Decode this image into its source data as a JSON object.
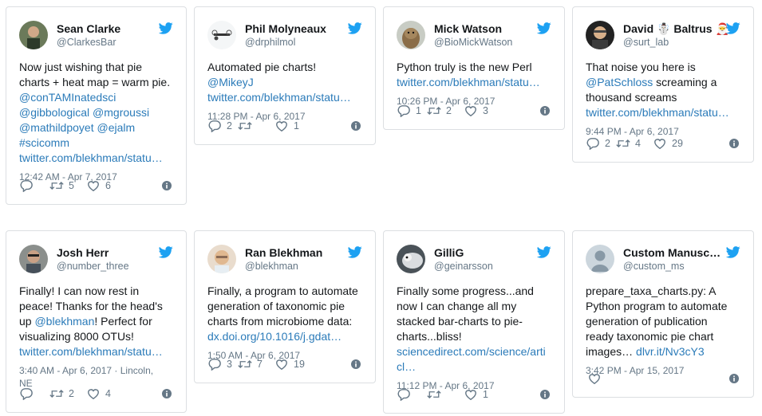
{
  "tweets": [
    {
      "name": "Sean Clarke",
      "handle": "@ClarkesBar",
      "avatar": "person-photo-avatar",
      "lines": [
        [
          {
            "t": "Now just wishing that pie",
            "link": false
          }
        ],
        [
          {
            "t": "charts + heat map = warm pie.",
            "link": false
          }
        ],
        [
          {
            "t": "@conTAMInatedsci",
            "link": true
          }
        ],
        [
          {
            "t": "@gibbological @mgroussi",
            "link": true
          }
        ],
        [
          {
            "t": "@mathildpoyet @ejalm",
            "link": true
          }
        ],
        [
          {
            "t": "#scicomm",
            "link": true
          }
        ],
        [
          {
            "t": "twitter.com/blekhman/statu…",
            "link": true
          }
        ]
      ],
      "time": "12:42 AM - Apr 7, 2017",
      "reply": "",
      "retweet": "5",
      "like": "6"
    },
    {
      "name": "Phil Molyneaux",
      "handle": "@drphilmol",
      "avatar": "drone-avatar",
      "lines": [
        [
          {
            "t": "Automated pie charts!",
            "link": false
          }
        ],
        [
          {
            "t": "@MikeyJ",
            "link": true
          }
        ],
        [
          {
            "t": "twitter.com/blekhman/statu…",
            "link": true
          }
        ]
      ],
      "time": "11:28 PM - Apr 6, 2017",
      "reply": "2",
      "retweet": "",
      "like": "1"
    },
    {
      "name": "Mick Watson",
      "handle": "@BioMickWatson",
      "avatar": "otter-avatar",
      "lines": [
        [
          {
            "t": "Python truly is the new Perl",
            "link": false
          }
        ],
        [
          {
            "t": "twitter.com/blekhman/statu…",
            "link": true
          }
        ]
      ],
      "time": "10:26 PM - Apr 6, 2017",
      "reply": "1",
      "retweet": "2",
      "like": "3"
    },
    {
      "name": "David ☃️ Baltrus 🎅",
      "handle": "@surt_lab",
      "avatar": "person-photo-avatar",
      "lines": [
        [
          {
            "t": "That noise you here is",
            "link": false
          }
        ],
        [
          {
            "t": "@PatSchloss",
            "link": true
          },
          {
            "t": " screaming a",
            "link": false
          }
        ],
        [
          {
            "t": "thousand screams",
            "link": false
          }
        ],
        [
          {
            "t": "twitter.com/blekhman/statu…",
            "link": true
          }
        ]
      ],
      "time": "9:44 PM - Apr 6, 2017",
      "reply": "2",
      "retweet": "4",
      "like": "29"
    },
    {
      "name": "Josh Herr",
      "handle": "@number_three",
      "avatar": "person-photo-avatar",
      "lines": [
        [
          {
            "t": "Finally! I can now rest in",
            "link": false
          }
        ],
        [
          {
            "t": "peace! Thanks for the head's",
            "link": false
          }
        ],
        [
          {
            "t": "up ",
            "link": false
          },
          {
            "t": "@blekhman",
            "link": true
          },
          {
            "t": "! Perfect for",
            "link": false
          }
        ],
        [
          {
            "t": "visualizing 8000 OTUs!",
            "link": false
          }
        ],
        [
          {
            "t": "twitter.com/blekhman/statu…",
            "link": true
          }
        ]
      ],
      "time": "3:40 AM - Apr 6, 2017 · Lincoln,",
      "time2": "NE",
      "reply": "",
      "retweet": "2",
      "like": "4"
    },
    {
      "name": "Ran Blekhman",
      "handle": "@blekhman",
      "avatar": "person-photo-avatar",
      "lines": [
        [
          {
            "t": "Finally, a program to automate",
            "link": false
          }
        ],
        [
          {
            "t": "generation of taxonomic pie",
            "link": false
          }
        ],
        [
          {
            "t": "charts from microbiome data:",
            "link": false
          }
        ],
        [
          {
            "t": "dx.doi.org/10.1016/j.gdat…",
            "link": true
          }
        ]
      ],
      "time": "1:50 AM - Apr 6, 2017",
      "reply": "3",
      "retweet": "7",
      "like": "19"
    },
    {
      "name": "GilliG",
      "handle": "@geinarsson",
      "avatar": "animal-photo-avatar",
      "lines": [
        [
          {
            "t": "Finally some progress...and",
            "link": false
          }
        ],
        [
          {
            "t": "now I can change all my",
            "link": false
          }
        ],
        [
          {
            "t": "stacked bar-charts to pie-",
            "link": false
          }
        ],
        [
          {
            "t": "charts...bliss!",
            "link": false
          }
        ],
        [
          {
            "t": "sciencedirect.com/science/arti",
            "link": true
          }
        ],
        [
          {
            "t": "cl…",
            "link": true
          }
        ]
      ],
      "time": "11:12 PM - Apr 6, 2017",
      "reply": "",
      "retweet": "",
      "like": "1"
    },
    {
      "name": "Custom Manusc…",
      "handle": "@custom_ms",
      "avatar": "default-egg-avatar",
      "lines": [
        [
          {
            "t": "prepare_taxa_charts.py: A",
            "link": false
          }
        ],
        [
          {
            "t": "Python program to automate",
            "link": false
          }
        ],
        [
          {
            "t": "generation of publication",
            "link": false
          }
        ],
        [
          {
            "t": "ready taxonomic pie chart",
            "link": false
          }
        ],
        [
          {
            "t": "images… ",
            "link": false
          },
          {
            "t": "dlvr.it/Nv3cY3",
            "link": true
          }
        ]
      ],
      "time": "3:42 PM - Apr 15, 2017",
      "reply": "",
      "retweet": "",
      "like": "",
      "only_like": true
    }
  ],
  "icons": {
    "bird": "twitter-bird-icon",
    "reply": "reply-icon",
    "retweet": "retweet-icon",
    "like": "heart-icon",
    "info": "info-icon"
  },
  "colors": {
    "link": "#2b7bb9",
    "bird": "#1da1f2",
    "muted": "#657786",
    "text": "#14171a",
    "border": "#dcdfe2"
  }
}
